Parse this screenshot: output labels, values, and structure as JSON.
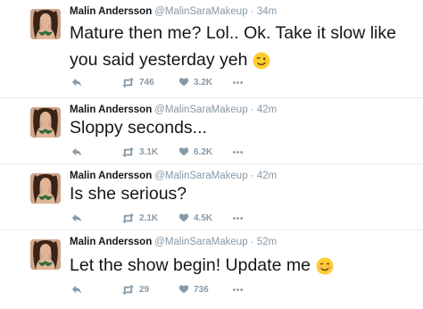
{
  "tweets": [
    {
      "name": "Malin Andersson",
      "handle": "@MalinSaraMakeup",
      "separator": "·",
      "time": "34m",
      "text_line1": "Mature then me? Lol.. Ok. Take it slow like",
      "text_line2": "you said yesterday yeh",
      "emoji": "winking-face",
      "retweets": "746",
      "likes": "3.2K"
    },
    {
      "name": "Malin Andersson",
      "handle": "@MalinSaraMakeup",
      "separator": "·",
      "time": "42m",
      "text_line1": "Sloppy seconds...",
      "retweets": "3.1K",
      "likes": "6.2K"
    },
    {
      "name": "Malin Andersson",
      "handle": "@MalinSaraMakeup",
      "separator": "·",
      "time": "42m",
      "text_line1": "Is she serious?",
      "retweets": "2.1K",
      "likes": "4.5K"
    },
    {
      "name": "Malin Andersson",
      "handle": "@MalinSaraMakeup",
      "separator": "·",
      "time": "52m",
      "text_line1": "Let the show begin! Update me",
      "emoji": "smiling-face",
      "retweets": "29",
      "likes": "736"
    }
  ],
  "colors": {
    "text": "#14171a",
    "muted": "#8899a6",
    "divider": "#e6ecf0",
    "emoji_yellow": "#ffcc33",
    "emoji_blush": "#f4a3a3"
  },
  "icons": [
    "reply-icon",
    "retweet-icon",
    "like-icon",
    "more-icon"
  ]
}
